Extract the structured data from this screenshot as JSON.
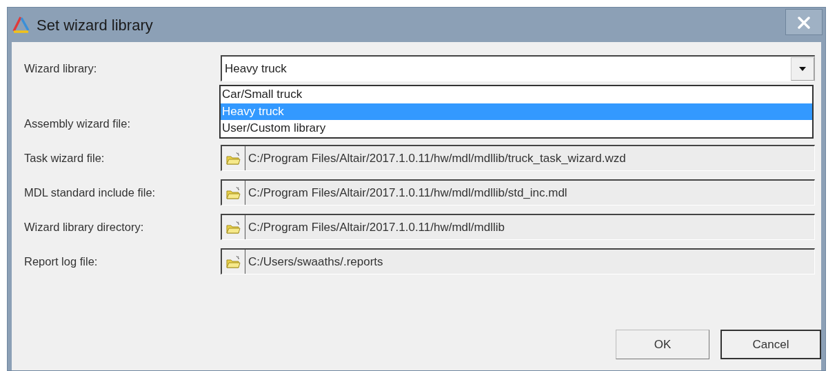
{
  "window": {
    "title": "Set wizard library"
  },
  "fields": [
    {
      "kind": "combo",
      "label": "Wizard library:",
      "value": "Heavy truck",
      "expanded": true,
      "options": [
        {
          "label": "Car/Small truck",
          "selected": false
        },
        {
          "label": "Heavy truck",
          "selected": true
        },
        {
          "label": "User/Custom library",
          "selected": false
        }
      ]
    },
    {
      "kind": "covered",
      "label": "Assembly wizard file:"
    },
    {
      "kind": "file",
      "label": "Task wizard file:",
      "value": "C:/Program Files/Altair/2017.1.0.11/hw/mdl/mdllib/truck_task_wizard.wzd"
    },
    {
      "kind": "file",
      "label": "MDL standard include file:",
      "value": "C:/Program Files/Altair/2017.1.0.11/hw/mdl/mdllib/std_inc.mdl"
    },
    {
      "kind": "file",
      "label": "Wizard library directory:",
      "value": "C:/Program Files/Altair/2017.1.0.11/hw/mdl/mdllib"
    },
    {
      "kind": "file",
      "label": "Report log file:",
      "value": "C:/Users/swaaths/.reports"
    }
  ],
  "buttons": [
    {
      "label": "OK",
      "default": false
    },
    {
      "label": "Cancel",
      "default": true
    }
  ]
}
